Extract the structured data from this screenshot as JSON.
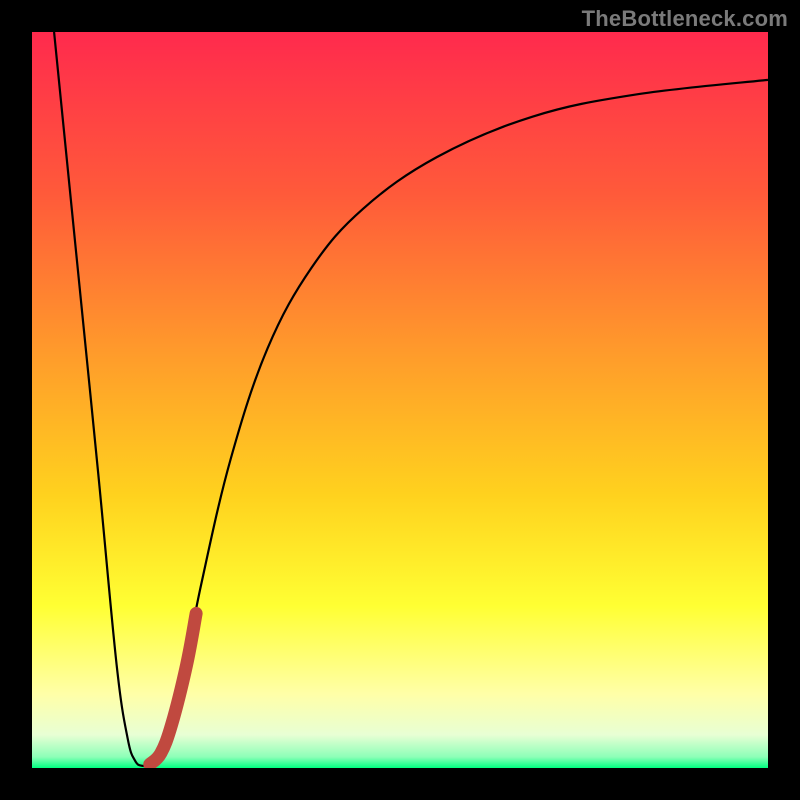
{
  "watermark": {
    "text": "TheBottleneck.com"
  },
  "chart_data": {
    "type": "line",
    "title": "",
    "xlabel": "",
    "ylabel": "",
    "xlim": [
      0,
      100
    ],
    "ylim": [
      0,
      100
    ],
    "gradient_stops": [
      {
        "offset": 0.0,
        "color": "#ff2a4d"
      },
      {
        "offset": 0.22,
        "color": "#ff5a3a"
      },
      {
        "offset": 0.45,
        "color": "#ff9f2a"
      },
      {
        "offset": 0.63,
        "color": "#ffd21e"
      },
      {
        "offset": 0.78,
        "color": "#ffff33"
      },
      {
        "offset": 0.9,
        "color": "#ffffa8"
      },
      {
        "offset": 0.955,
        "color": "#e8ffd4"
      },
      {
        "offset": 0.985,
        "color": "#8dffb8"
      },
      {
        "offset": 1.0,
        "color": "#00ff80"
      }
    ],
    "series": [
      {
        "name": "bottleneck-curve",
        "color": "#000000",
        "width": 2.2,
        "points": [
          {
            "x": 3.0,
            "y": 100.0
          },
          {
            "x": 6.0,
            "y": 70.0
          },
          {
            "x": 9.0,
            "y": 40.0
          },
          {
            "x": 11.5,
            "y": 14.0
          },
          {
            "x": 13.0,
            "y": 4.0
          },
          {
            "x": 14.0,
            "y": 1.0
          },
          {
            "x": 15.0,
            "y": 0.3
          },
          {
            "x": 16.5,
            "y": 0.6
          },
          {
            "x": 18.0,
            "y": 3.0
          },
          {
            "x": 20.0,
            "y": 10.0
          },
          {
            "x": 23.0,
            "y": 25.0
          },
          {
            "x": 27.0,
            "y": 42.0
          },
          {
            "x": 32.0,
            "y": 57.0
          },
          {
            "x": 38.0,
            "y": 68.0
          },
          {
            "x": 45.0,
            "y": 76.0
          },
          {
            "x": 55.0,
            "y": 83.0
          },
          {
            "x": 68.0,
            "y": 88.5
          },
          {
            "x": 82.0,
            "y": 91.5
          },
          {
            "x": 100.0,
            "y": 93.5
          }
        ]
      },
      {
        "name": "highlight-segment",
        "color": "#c0493f",
        "width": 13,
        "linecap": "round",
        "points": [
          {
            "x": 16.0,
            "y": 0.5
          },
          {
            "x": 17.5,
            "y": 2.0
          },
          {
            "x": 19.0,
            "y": 6.0
          },
          {
            "x": 21.0,
            "y": 14.0
          },
          {
            "x": 22.3,
            "y": 21.0
          }
        ]
      }
    ]
  }
}
